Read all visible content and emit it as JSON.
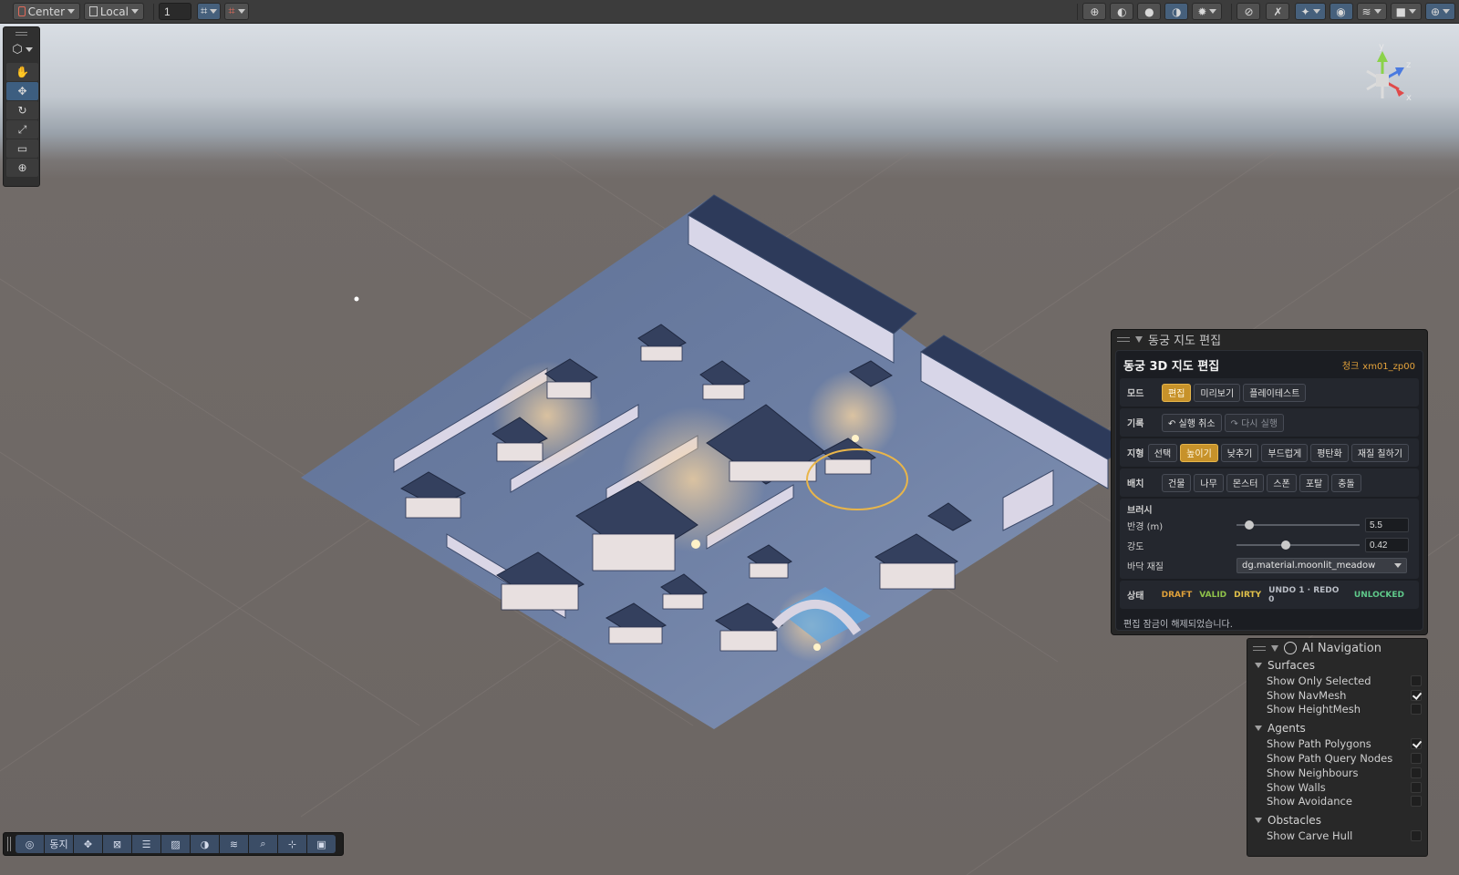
{
  "toolbar": {
    "pivot_label": "Center",
    "space_label": "Local",
    "grid_value": "1",
    "icons_left": [
      "pivot-icon",
      "global-icon",
      "grid-snap-icon",
      "increment-snap-icon"
    ],
    "icons_right": [
      "draw-mode-icon",
      "shading-wireframe-icon",
      "shading-shaded-icon",
      "shading-lit-icon",
      "effects-icon",
      "audio-mute-icon",
      "lighting-toggle-icon",
      "layers-icon",
      "visibility-icon",
      "stack-icon",
      "camera-icon",
      "gizmos-icon"
    ]
  },
  "tools": [
    "view-tool",
    "hand-tool",
    "move-tool",
    "rotate-tool",
    "scale-tool",
    "rect-tool",
    "transform-tool"
  ],
  "gizmo": {
    "y_label": "y",
    "x_label": "x",
    "z_label": "z"
  },
  "map_editor": {
    "window_title": "동궁 지도 편집",
    "title": "동궁 3D 지도 편집",
    "chunk_label": "청크",
    "chunk_id": "xm01_zp00",
    "mode": {
      "label": "모드",
      "options": [
        "편집",
        "미리보기",
        "플레이테스트"
      ],
      "selected": "편집"
    },
    "history": {
      "label": "기록",
      "undo": "↶ 실행 취소",
      "redo": "↷ 다시 실행"
    },
    "terrain": {
      "label": "지형",
      "options": [
        "선택",
        "높이기",
        "낮추기",
        "부드럽게",
        "평탄화",
        "재질 칠하기"
      ],
      "selected": "높이기"
    },
    "placement": {
      "label": "배치",
      "options": [
        "건물",
        "나무",
        "몬스터",
        "스폰",
        "포탈",
        "충돌"
      ]
    },
    "brush": {
      "title": "브러시",
      "radius_label": "반경 (m)",
      "radius_value": "5.5",
      "radius_fraction": 0.1,
      "strength_label": "강도",
      "strength_value": "0.42",
      "strength_fraction": 0.4,
      "material_label": "바닥 재질",
      "material_value": "dg.material.moonlit_meadow"
    },
    "status": {
      "label": "상태",
      "tags": [
        {
          "text": "DRAFT",
          "color": "#e0a13a"
        },
        {
          "text": "VALID",
          "color": "#8fc24a"
        },
        {
          "text": "DIRTY",
          "color": "#e0c04a"
        },
        {
          "text": "UNDO 1 · REDO 0",
          "color": "#b8bcc4"
        },
        {
          "text": "UNLOCKED",
          "color": "#5fc98a"
        }
      ]
    },
    "message": "편집 잠금이 해제되었습니다."
  },
  "ai_navigation": {
    "title": "AI Navigation",
    "sections": [
      {
        "title": "Surfaces",
        "items": [
          {
            "label": "Show Only Selected",
            "checked": false
          },
          {
            "label": "Show NavMesh",
            "checked": true
          },
          {
            "label": "Show HeightMesh",
            "checked": false
          }
        ]
      },
      {
        "title": "Agents",
        "items": [
          {
            "label": "Show Path Polygons",
            "checked": true
          },
          {
            "label": "Show Path Query Nodes",
            "checked": false
          },
          {
            "label": "Show Neighbours",
            "checked": false
          },
          {
            "label": "Show Walls",
            "checked": false
          },
          {
            "label": "Show Avoidance",
            "checked": false
          }
        ]
      },
      {
        "title": "Obstacles",
        "items": [
          {
            "label": "Show Carve Hull",
            "checked": false
          }
        ]
      }
    ]
  },
  "bottom_bar": {
    "items": [
      "navigation-icon",
      "동지",
      "move-icon",
      "crop-icon",
      "align-icon",
      "hatch-icon",
      "lighting-icon",
      "layers-icon",
      "zoom-icon",
      "pivot-icon",
      "camera-icon"
    ]
  }
}
